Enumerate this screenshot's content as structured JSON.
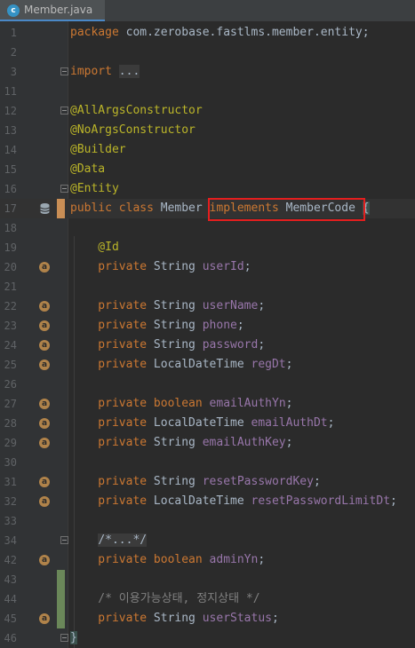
{
  "tab": {
    "label": "Member.java",
    "icon": "java-class-icon"
  },
  "lines": [
    {
      "num": "1",
      "tokens": [
        {
          "t": "package ",
          "c": "kw"
        },
        {
          "t": "com.zerobase.fastlms.member.entity;",
          "c": ""
        }
      ]
    },
    {
      "num": "2",
      "tokens": []
    },
    {
      "num": "3",
      "tokens": [
        {
          "t": "import ",
          "c": "kw"
        },
        {
          "t": "...",
          "c": "fold-txt"
        }
      ],
      "fold": true
    },
    {
      "num": "11",
      "tokens": []
    },
    {
      "num": "12",
      "tokens": [
        {
          "t": "@AllArgsConstructor",
          "c": "ann"
        }
      ],
      "fold": true
    },
    {
      "num": "13",
      "tokens": [
        {
          "t": "@NoArgsConstructor",
          "c": "ann"
        }
      ]
    },
    {
      "num": "14",
      "tokens": [
        {
          "t": "@Builder",
          "c": "ann"
        }
      ]
    },
    {
      "num": "15",
      "tokens": [
        {
          "t": "@Data",
          "c": "ann"
        }
      ]
    },
    {
      "num": "16",
      "tokens": [
        {
          "t": "@Entity",
          "c": "ann"
        }
      ],
      "fold": true
    },
    {
      "num": "17",
      "tokens": [
        {
          "t": "public class ",
          "c": "kw"
        },
        {
          "t": "Member ",
          "c": ""
        },
        {
          "t": "implements ",
          "c": "kw"
        },
        {
          "t": "MemberCode ",
          "c": ""
        },
        {
          "t": "{",
          "c": "brace-hl"
        }
      ],
      "current": true,
      "marker": "db-icon",
      "change": "mod"
    },
    {
      "num": "18",
      "tokens": []
    },
    {
      "num": "19",
      "tokens": [
        {
          "t": "    @Id",
          "c": "ann"
        }
      ]
    },
    {
      "num": "20",
      "tokens": [
        {
          "t": "    private ",
          "c": "kw"
        },
        {
          "t": "String ",
          "c": ""
        },
        {
          "t": "userId",
          "c": "fld"
        },
        {
          "t": ";",
          "c": ""
        }
      ],
      "marker": "field-key"
    },
    {
      "num": "21",
      "tokens": []
    },
    {
      "num": "22",
      "tokens": [
        {
          "t": "    private ",
          "c": "kw"
        },
        {
          "t": "String ",
          "c": ""
        },
        {
          "t": "userName",
          "c": "fld"
        },
        {
          "t": ";",
          "c": ""
        }
      ],
      "marker": "field"
    },
    {
      "num": "23",
      "tokens": [
        {
          "t": "    private ",
          "c": "kw"
        },
        {
          "t": "String ",
          "c": ""
        },
        {
          "t": "phone",
          "c": "fld"
        },
        {
          "t": ";",
          "c": ""
        }
      ],
      "marker": "field"
    },
    {
      "num": "24",
      "tokens": [
        {
          "t": "    private ",
          "c": "kw"
        },
        {
          "t": "String ",
          "c": ""
        },
        {
          "t": "password",
          "c": "fld"
        },
        {
          "t": ";",
          "c": ""
        }
      ],
      "marker": "field"
    },
    {
      "num": "25",
      "tokens": [
        {
          "t": "    private ",
          "c": "kw"
        },
        {
          "t": "LocalDateTime ",
          "c": ""
        },
        {
          "t": "regDt",
          "c": "fld"
        },
        {
          "t": ";",
          "c": ""
        }
      ],
      "marker": "field"
    },
    {
      "num": "26",
      "tokens": []
    },
    {
      "num": "27",
      "tokens": [
        {
          "t": "    private ",
          "c": "kw"
        },
        {
          "t": "boolean ",
          "c": "kw"
        },
        {
          "t": "emailAuthYn",
          "c": "fld"
        },
        {
          "t": ";",
          "c": ""
        }
      ],
      "marker": "field"
    },
    {
      "num": "28",
      "tokens": [
        {
          "t": "    private ",
          "c": "kw"
        },
        {
          "t": "LocalDateTime ",
          "c": ""
        },
        {
          "t": "emailAuthDt",
          "c": "fld"
        },
        {
          "t": ";",
          "c": ""
        }
      ],
      "marker": "field"
    },
    {
      "num": "29",
      "tokens": [
        {
          "t": "    private ",
          "c": "kw"
        },
        {
          "t": "String ",
          "c": ""
        },
        {
          "t": "emailAuthKey",
          "c": "fld"
        },
        {
          "t": ";",
          "c": ""
        }
      ],
      "marker": "field"
    },
    {
      "num": "30",
      "tokens": []
    },
    {
      "num": "31",
      "tokens": [
        {
          "t": "    private ",
          "c": "kw"
        },
        {
          "t": "String ",
          "c": ""
        },
        {
          "t": "resetPasswordKey",
          "c": "fld"
        },
        {
          "t": ";",
          "c": ""
        }
      ],
      "marker": "field"
    },
    {
      "num": "32",
      "tokens": [
        {
          "t": "    private ",
          "c": "kw"
        },
        {
          "t": "LocalDateTime ",
          "c": ""
        },
        {
          "t": "resetPasswordLimitDt",
          "c": "fld"
        },
        {
          "t": ";",
          "c": ""
        }
      ],
      "marker": "field"
    },
    {
      "num": "33",
      "tokens": []
    },
    {
      "num": "34",
      "tokens": [
        {
          "t": "    ",
          "c": ""
        },
        {
          "t": "/*...*/",
          "c": "fold-txt"
        }
      ],
      "fold": true
    },
    {
      "num": "42",
      "tokens": [
        {
          "t": "    private ",
          "c": "kw"
        },
        {
          "t": "boolean ",
          "c": "kw"
        },
        {
          "t": "adminYn",
          "c": "fld"
        },
        {
          "t": ";",
          "c": ""
        }
      ],
      "marker": "field"
    },
    {
      "num": "43",
      "tokens": [],
      "change": "add"
    },
    {
      "num": "44",
      "tokens": [
        {
          "t": "    /* 이용가능상태, 정지상태 */",
          "c": "cmt"
        }
      ],
      "change": "add"
    },
    {
      "num": "45",
      "tokens": [
        {
          "t": "    private ",
          "c": "kw"
        },
        {
          "t": "String ",
          "c": ""
        },
        {
          "t": "userStatus",
          "c": "fld"
        },
        {
          "t": ";",
          "c": ""
        }
      ],
      "marker": "field",
      "change": "add"
    },
    {
      "num": "46",
      "tokens": [
        {
          "t": "}",
          "c": "brace-hl"
        }
      ],
      "fold": true
    }
  ],
  "highlight_label": "implements MemberCode",
  "colors": {
    "keyword": "#cc7832",
    "annotation": "#bbb529",
    "field": "#9876aa",
    "comment": "#808080",
    "highlight_box": "#e41e1e"
  }
}
